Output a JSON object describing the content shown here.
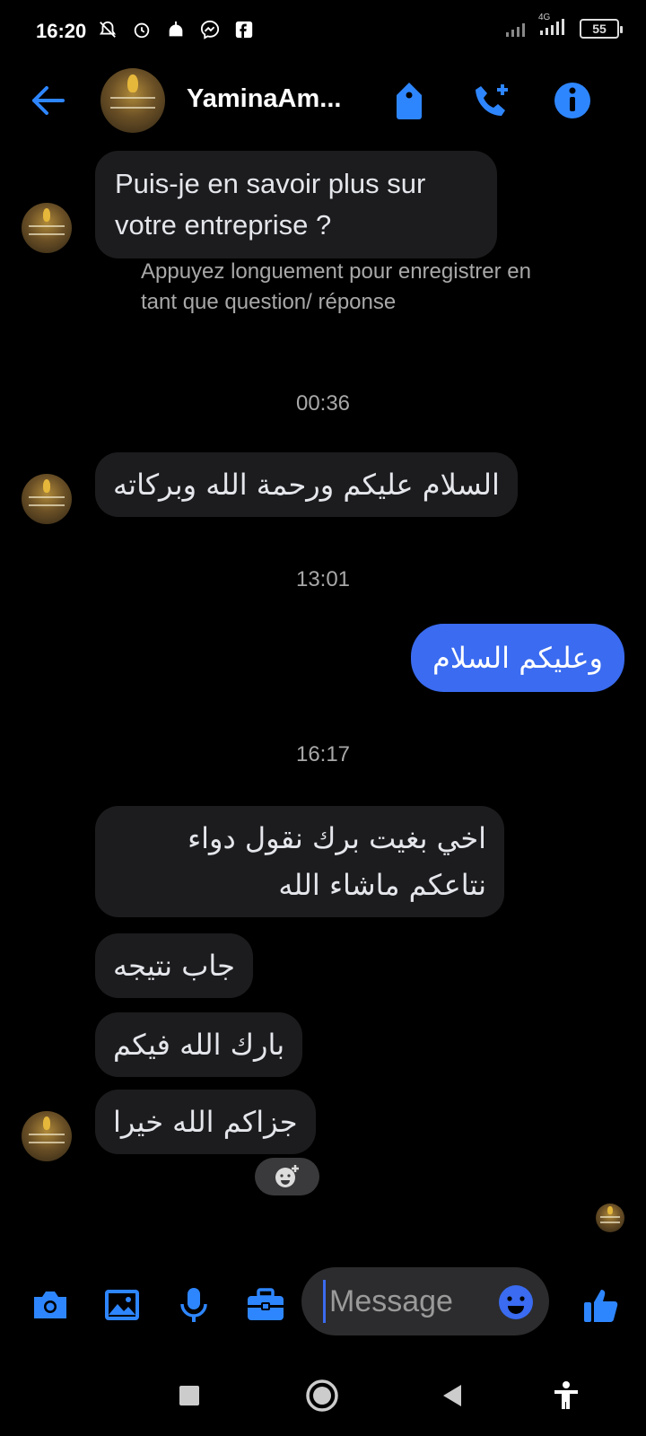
{
  "status_bar": {
    "time": "16:20",
    "network_label": "4G",
    "battery": "55"
  },
  "header": {
    "contact_name": "YaminaAm...",
    "accent_color": "#2e86ff"
  },
  "messages": {
    "m1": {
      "text": "Puis-je en savoir plus sur votre entreprise ?"
    },
    "hint": "Appuyez longuement pour enregistrer en tant que question/ réponse",
    "ts1": "00:36",
    "m2": {
      "text": "السلام عليكم ورحمة الله وبركاته"
    },
    "ts2": "13:01",
    "m3": {
      "text": "وعليكم السلام"
    },
    "ts3": "16:17",
    "m4": {
      "text": "اخي بغيت برك نقول دواء نتاعكم ماشاء الله"
    },
    "m5": {
      "text": "جاب نتيجه"
    },
    "m6": {
      "text": "بارك الله فيكم"
    },
    "m7": {
      "text": "جزاكم الله خيرا"
    }
  },
  "composer": {
    "placeholder": "Message"
  },
  "icons": {
    "header": [
      "back-arrow-icon",
      "tag-icon",
      "add-call-icon",
      "info-icon"
    ],
    "composer": [
      "camera-icon",
      "image-icon",
      "microphone-icon",
      "briefcase-icon",
      "emoji-icon",
      "thumbs-up-icon"
    ],
    "nav": [
      "recents-icon",
      "home-icon",
      "back-icon",
      "accessibility-icon"
    ]
  }
}
